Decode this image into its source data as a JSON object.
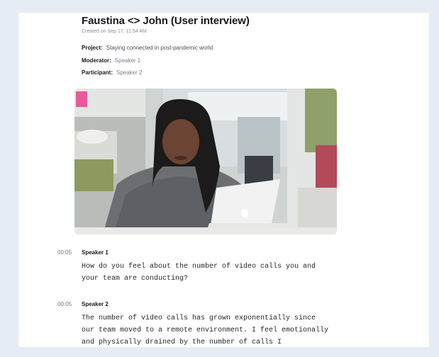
{
  "document": {
    "title": "Faustina <> John (User interview)",
    "created": "Created on Sep 17, 11:54 AM",
    "project_label": "Project:",
    "project_value": "Staying connected in post-pandemic world",
    "moderator_label": "Moderator:",
    "moderator_value": "Speaker 1",
    "participant_label": "Participant:",
    "participant_value": "Speaker 2"
  },
  "transcript": [
    {
      "timestamp": "00:05",
      "speaker": "Speaker 1",
      "lines": [
        "How do you feel about the number of video calls you and",
        "your team are conducting?"
      ]
    },
    {
      "timestamp": "00:05",
      "speaker": "Speaker 2",
      "lines": [
        "The number of video calls has grown exponentially since",
        "our team moved to a remote environment. I feel emotionally",
        "and physically drained by the number of calls I"
      ]
    }
  ],
  "colors": {
    "page_bg": "#e6ecf4",
    "sheet_bg": "#ffffff",
    "text": "#16181d",
    "muted": "#7a808a"
  }
}
